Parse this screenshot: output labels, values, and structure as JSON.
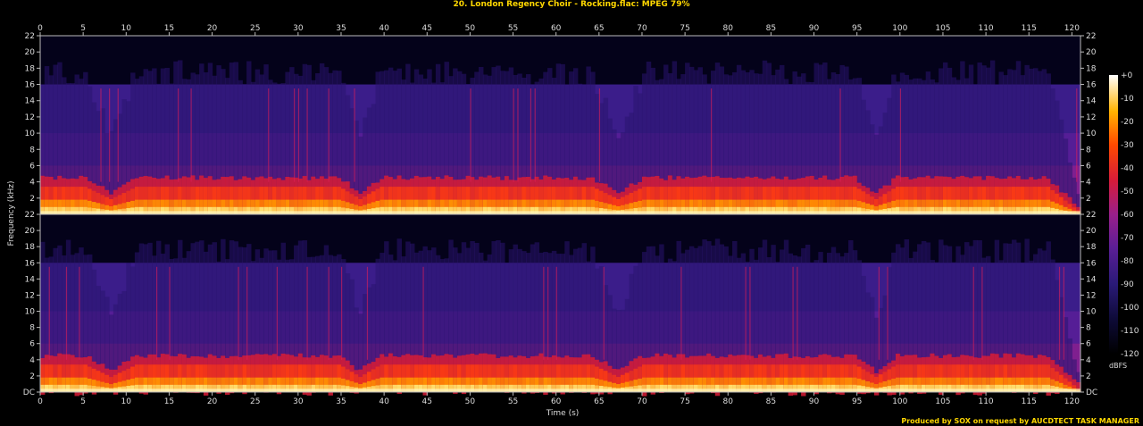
{
  "chart_data": {
    "type": "heatmap",
    "title": "20. London Regency Choir - Rocking.flac: MPEG 79%",
    "xlabel": "Time (s)",
    "ylabel": "Frequency (kHz)",
    "xlim": [
      0,
      121
    ],
    "ylim": [
      0,
      22
    ],
    "x_ticks": [
      0,
      5,
      10,
      15,
      20,
      25,
      30,
      35,
      40,
      45,
      50,
      55,
      60,
      65,
      70,
      75,
      80,
      85,
      90,
      95,
      100,
      105,
      110,
      115,
      120
    ],
    "y_ticks": [
      "DC",
      "2",
      "4",
      "6",
      "8",
      "10",
      "12",
      "14",
      "16",
      "18",
      "20",
      "22"
    ],
    "channels": 2,
    "lowpass_cutoff_khz": 16,
    "colorbar": {
      "unit": "dBFS",
      "ticks": [
        "+0",
        "-10",
        "-20",
        "-30",
        "-40",
        "-50",
        "-60",
        "-70",
        "-80",
        "-90",
        "-100",
        "-110",
        "-120"
      ],
      "range": [
        -120,
        0
      ]
    }
  },
  "footer": "Produced by SOX on request by AUCDTECT TASK MANAGER",
  "colors": {
    "title": "#ffd700",
    "axis": "#dddddd",
    "background": "#000000"
  }
}
